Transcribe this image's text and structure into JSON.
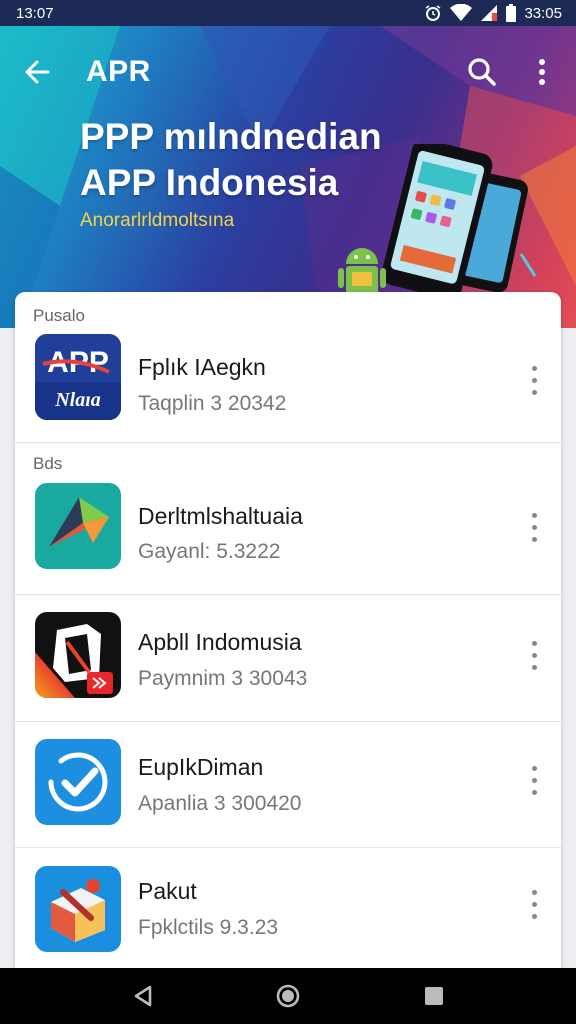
{
  "status_bar": {
    "time": "13:07",
    "right_time": "33:05",
    "icons": [
      "alarm-icon",
      "wifi-icon",
      "signal-icon",
      "battery-icon"
    ]
  },
  "app_bar": {
    "title": "APR",
    "back_icon": "arrow-back-icon",
    "search_icon": "search-icon",
    "more_icon": "more-vert-icon"
  },
  "hero": {
    "title_line1": "PPP mılndnedian",
    "title_line2": "APP Indonesia",
    "subtitle": "Anorarlrldmoltsına"
  },
  "sections": [
    {
      "label": "Pusalo"
    },
    {
      "label": "Bds"
    }
  ],
  "apps": [
    {
      "name": "Fplık IAegkn",
      "version": "Taqplin 3 20342",
      "icon_text_top": "APP",
      "icon_text_bottom": "Nlaıa"
    },
    {
      "name": "Derltmlshaltuaia",
      "version": "Gayanl: 5.3222"
    },
    {
      "name": "Apbll Indomusia",
      "version": "Paymnim 3 30043"
    },
    {
      "name": "EupIkDiman",
      "version": "Apanlia 3 300420"
    },
    {
      "name": "Pakut",
      "version": "Fpklctils 9.3.23"
    }
  ],
  "colors": {
    "status_bar": "#1c2a55",
    "accent_yellow": "#f4d34a",
    "app1_icon": "#1f3f9a",
    "app2_icon": "#1aa9a0",
    "app3_icon": "#111111",
    "app4_icon": "#1e8fe0",
    "app5_icon": "#1a8fe0"
  },
  "nav_bar": {
    "icons": [
      "back-triangle-icon",
      "home-circle-icon",
      "recents-square-icon"
    ]
  }
}
